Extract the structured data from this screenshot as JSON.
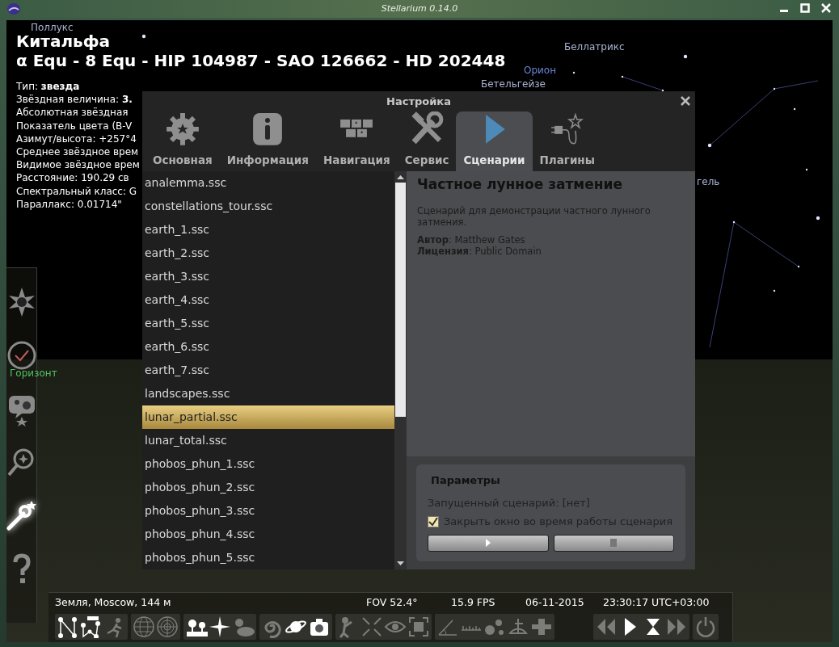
{
  "window": {
    "title": "Stellarium 0.14.0"
  },
  "sky_labels": [
    {
      "text": "Поллукс",
      "kind": "star"
    },
    {
      "text": "Беллатрикс",
      "kind": "star"
    },
    {
      "text": "Орион",
      "kind": "constellation"
    },
    {
      "text": "Бетельгейзе",
      "kind": "star"
    },
    {
      "text": "гель",
      "kind": "star"
    },
    {
      "text": "Горизонт",
      "kind": "horizon"
    }
  ],
  "object_info": {
    "name": "Китальфа",
    "designations": "α Equ - 8 Equ - HIP 104987 - SAO 126662 - HD 202448",
    "lines": [
      "Тип: **звезда**",
      "Звёздная величина: **3.**",
      "Абсолютная звёздная",
      "Показатель цвета (B-V",
      "Азимут/высота: +257°4",
      "Среднее звёздное врем",
      "Видимое звёздное врем",
      "Расстояние: 190.29 св",
      "Спектральный класс: G",
      "Параллакс: 0.01714\""
    ]
  },
  "dialog": {
    "title": "Настройка",
    "tabs": [
      {
        "label": "Основная",
        "selected": false
      },
      {
        "label": "Информация",
        "selected": false
      },
      {
        "label": "Навигация",
        "selected": false
      },
      {
        "label": "Сервис",
        "selected": false
      },
      {
        "label": "Сценарии",
        "selected": true
      },
      {
        "label": "Плагины",
        "selected": false
      }
    ],
    "scripts": [
      {
        "label": "analemma.ssc",
        "selected": false
      },
      {
        "label": "constellations_tour.ssc",
        "selected": false
      },
      {
        "label": "earth_1.ssc",
        "selected": false
      },
      {
        "label": "earth_2.ssc",
        "selected": false
      },
      {
        "label": "earth_3.ssc",
        "selected": false
      },
      {
        "label": "earth_4.ssc",
        "selected": false
      },
      {
        "label": "earth_5.ssc",
        "selected": false
      },
      {
        "label": "earth_6.ssc",
        "selected": false
      },
      {
        "label": "earth_7.ssc",
        "selected": false
      },
      {
        "label": "landscapes.ssc",
        "selected": false
      },
      {
        "label": "lunar_partial.ssc",
        "selected": true
      },
      {
        "label": "lunar_total.ssc",
        "selected": false
      },
      {
        "label": "phobos_phun_1.ssc",
        "selected": false
      },
      {
        "label": "phobos_phun_2.ssc",
        "selected": false
      },
      {
        "label": "phobos_phun_3.ssc",
        "selected": false
      },
      {
        "label": "phobos_phun_4.ssc",
        "selected": false
      },
      {
        "label": "phobos_phun_5.ssc",
        "selected": false
      }
    ],
    "detail": {
      "title": "Частное лунное затмение",
      "description": "Сценарий для демонстрации частного лунного затмения.",
      "meta": [
        "**Автор**: Matthew Gates",
        "**Лицензия**: Public Domain"
      ]
    },
    "parameters": {
      "title": "Параметры",
      "running": "Запущенный сценарий: [нет]",
      "close_window": {
        "label": "Закрыть окно во время работы сценария",
        "checked": true
      },
      "buttons": [
        {
          "kind": "play"
        },
        {
          "kind": "stop"
        }
      ]
    }
  },
  "sidebar": [
    {
      "kind": "location",
      "active": false
    },
    {
      "kind": "time",
      "active": false
    },
    {
      "kind": "sky",
      "active": false
    },
    {
      "kind": "search",
      "active": false
    },
    {
      "kind": "settings",
      "active": true
    },
    {
      "kind": "help",
      "active": false
    }
  ],
  "status": {
    "location": "Земля, Moscow, 144 м",
    "fov": "FOV 52.4°",
    "fps": "15.9 FPS",
    "date": "06-11-2015",
    "time": "23:30:17 UTC+03:00"
  },
  "toolbar": [
    [
      {
        "kind": "lines",
        "on": true
      },
      {
        "kind": "names",
        "on": true
      },
      {
        "kind": "art",
        "on": false
      }
    ],
    [
      {
        "kind": "globe",
        "on": false
      },
      {
        "kind": "radar",
        "on": false
      }
    ],
    [
      {
        "kind": "ground",
        "on": true
      },
      {
        "kind": "sparkle",
        "on": true
      },
      {
        "kind": "cloud",
        "on": false
      }
    ],
    [
      {
        "kind": "spiral",
        "on": false
      },
      {
        "kind": "planet",
        "on": true
      },
      {
        "kind": "camera",
        "on": true
      }
    ],
    [
      {
        "kind": "figure",
        "on": false
      },
      {
        "kind": "arrows",
        "on": false
      },
      {
        "kind": "eye",
        "on": false
      },
      {
        "kind": "frame",
        "on": false
      }
    ],
    [
      {
        "kind": "angle",
        "on": false
      },
      {
        "kind": "ruler",
        "on": false
      },
      {
        "kind": "dots",
        "on": false
      },
      {
        "kind": "sextant",
        "on": false
      },
      {
        "kind": "cross",
        "on": false
      }
    ],
    [
      {
        "kind": "rewind",
        "on": false
      },
      {
        "kind": "play",
        "on": true
      },
      {
        "kind": "hourglass",
        "on": true
      },
      {
        "kind": "forward",
        "on": false
      }
    ],
    [
      {
        "kind": "power",
        "on": false
      }
    ]
  ]
}
